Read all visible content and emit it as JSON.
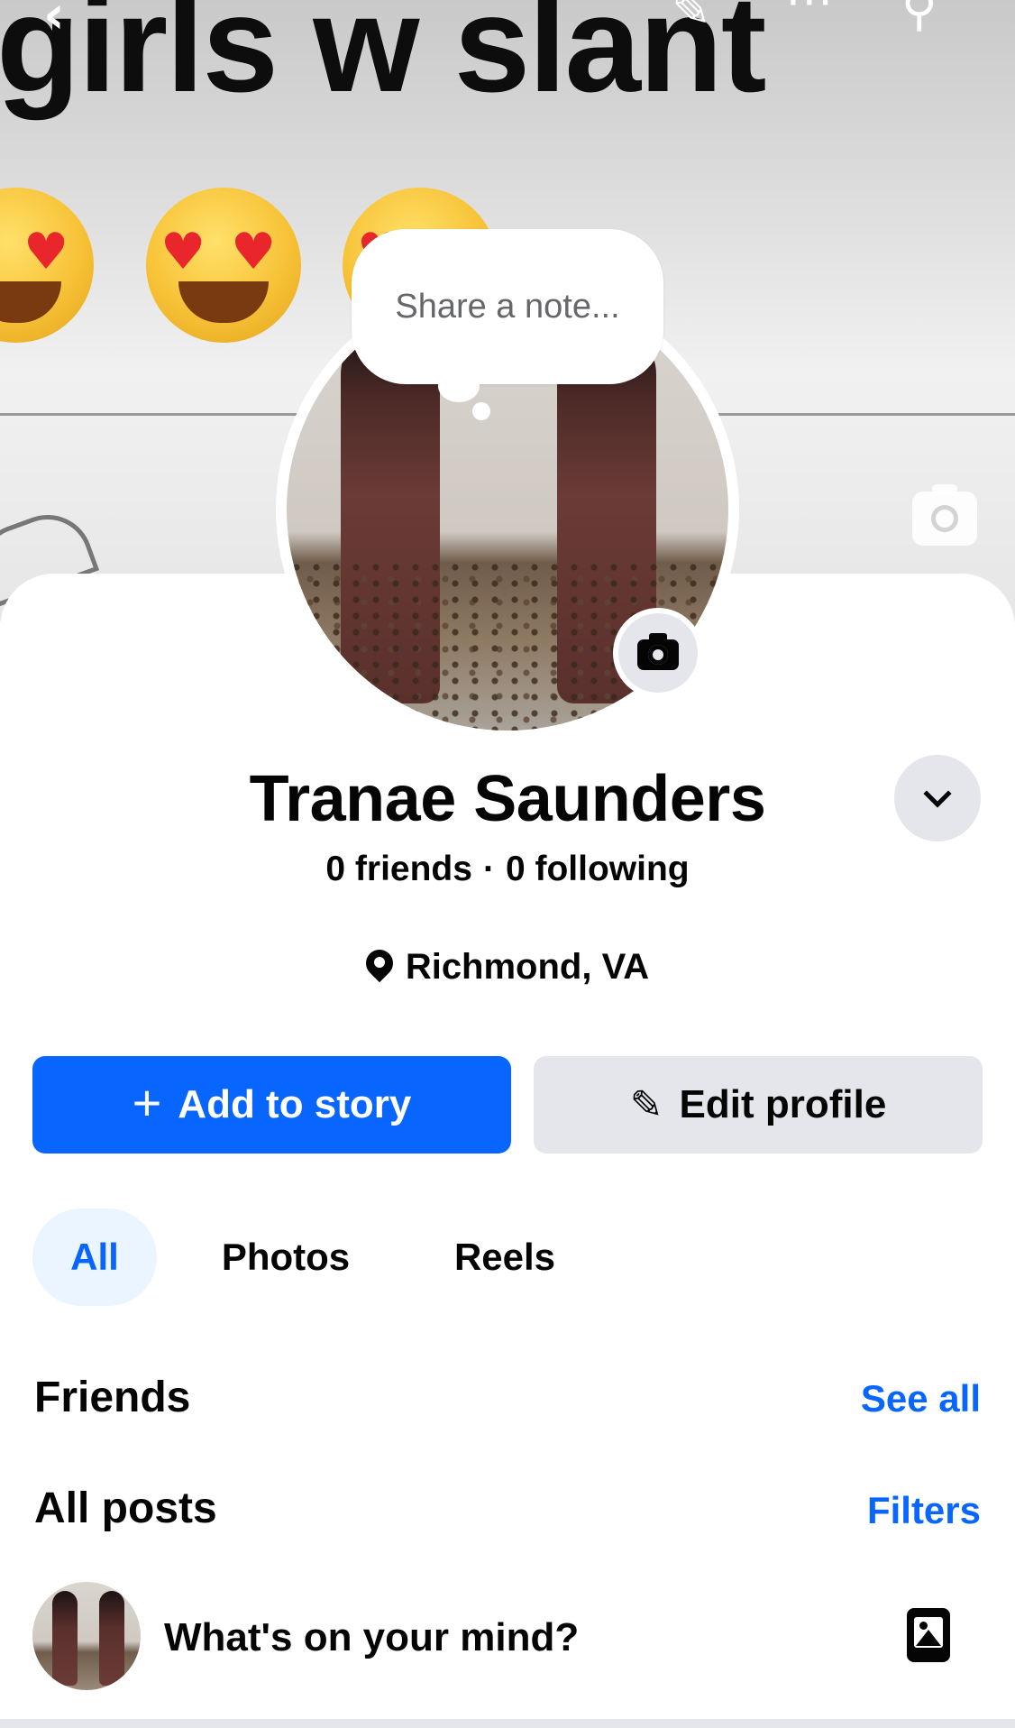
{
  "cover": {
    "caption": "girls w slant",
    "emoji_count": 3,
    "icons": [
      "back-icon",
      "edit-icon",
      "more-icon",
      "search-icon",
      "camera-icon"
    ]
  },
  "note_prompt": "Share a note...",
  "profile": {
    "name": "Tranae Saunders",
    "friends": "0 friends",
    "separator": "·",
    "following": "0 following",
    "location": "Richmond, VA"
  },
  "actions": {
    "add_story": "Add to story",
    "edit_profile": "Edit profile"
  },
  "tabs": [
    {
      "label": "All",
      "active": true
    },
    {
      "label": "Photos",
      "active": false
    },
    {
      "label": "Reels",
      "active": false
    }
  ],
  "friends_section": {
    "title": "Friends",
    "link": "See all"
  },
  "posts_section": {
    "title": "All posts",
    "link": "Filters"
  },
  "composer": {
    "prompt": "What's on your mind?"
  },
  "colors": {
    "accent": "#0866ff",
    "button_secondary": "#e4e6eb",
    "tab_active_bg": "#ebf5ff",
    "text_primary": "#050505",
    "text_secondary": "#65676b"
  }
}
